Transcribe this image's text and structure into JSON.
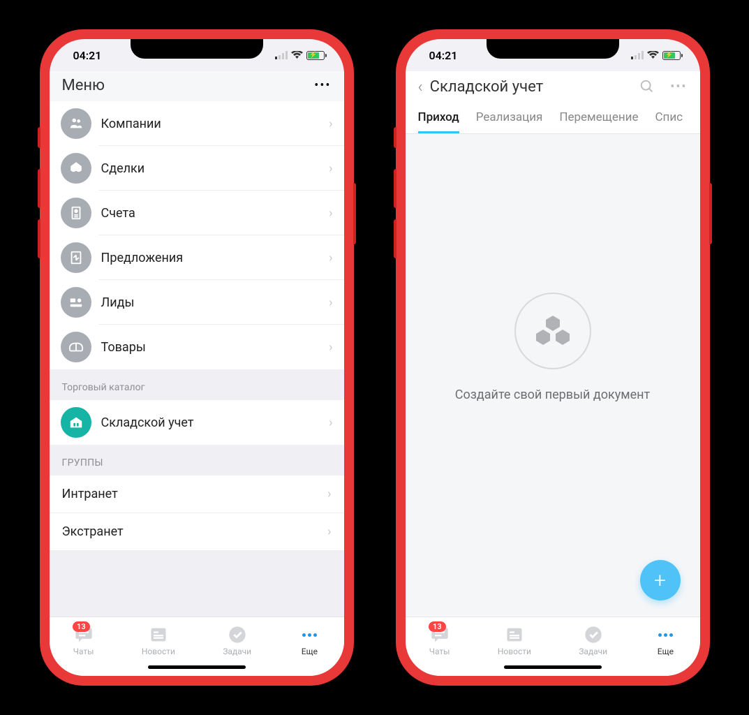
{
  "status": {
    "time": "04:21"
  },
  "phone1": {
    "header": {
      "title": "Меню"
    },
    "menu": {
      "items": [
        {
          "label": "Компании",
          "icon": "companies"
        },
        {
          "label": "Сделки",
          "icon": "deals"
        },
        {
          "label": "Счета",
          "icon": "invoices"
        },
        {
          "label": "Предложения",
          "icon": "offers"
        },
        {
          "label": "Лиды",
          "icon": "leads"
        },
        {
          "label": "Товары",
          "icon": "products"
        }
      ]
    },
    "section_catalog": "Торговый каталог",
    "catalog_item": {
      "label": "Складской учет"
    },
    "section_groups": "ГРУППЫ",
    "groups": [
      {
        "label": "Интранет"
      },
      {
        "label": "Экстранет"
      }
    ]
  },
  "phone2": {
    "header": {
      "title": "Складской учет"
    },
    "tabs": [
      {
        "label": "Приход",
        "active": true
      },
      {
        "label": "Реализация"
      },
      {
        "label": "Перемещение"
      },
      {
        "label": "Спис"
      }
    ],
    "empty": {
      "text": "Создайте свой первый документ"
    }
  },
  "tabbar": {
    "items": [
      {
        "label": "Чаты",
        "badge": "13"
      },
      {
        "label": "Новости"
      },
      {
        "label": "Задачи"
      },
      {
        "label": "Еще",
        "active": true
      }
    ]
  }
}
